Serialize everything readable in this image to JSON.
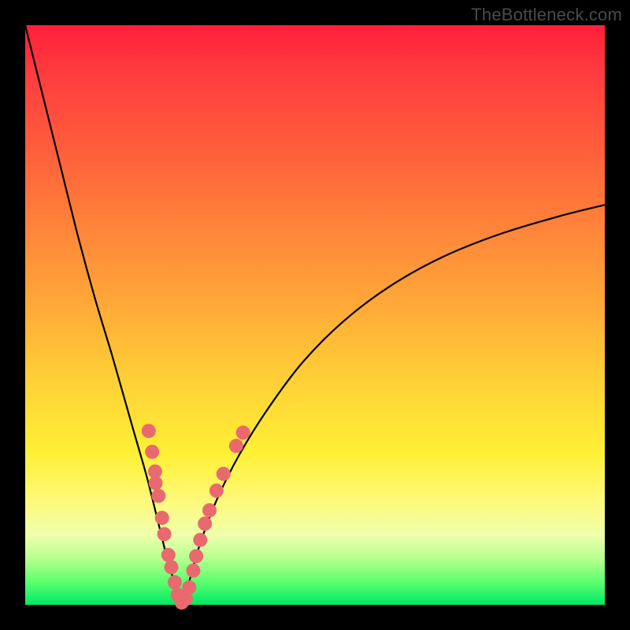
{
  "watermark": "TheBottleneck.com",
  "colors": {
    "frame": "#000000",
    "gradient_top": "#ff1f3a",
    "gradient_bottom": "#00e866",
    "curve": "#000000",
    "dots": "#e86a6f"
  },
  "chart_data": {
    "type": "line",
    "title": "",
    "xlabel": "",
    "ylabel": "",
    "xlim": [
      0,
      100
    ],
    "ylim": [
      0,
      100
    ],
    "grid": false,
    "legend": false,
    "series": [
      {
        "name": "bottleneck-curve",
        "x": [
          0,
          3,
          6,
          9,
          12,
          15,
          17,
          19,
          21,
          23,
          24.5,
          26,
          27,
          28,
          30,
          33,
          37,
          42,
          48,
          55,
          63,
          72,
          82,
          92,
          100
        ],
        "y": [
          100,
          88,
          76,
          64,
          53,
          43,
          36,
          29,
          22,
          14,
          8,
          3,
          0,
          3,
          10,
          18,
          26,
          34,
          42,
          49,
          55,
          60,
          64,
          67,
          69
        ]
      }
    ],
    "markers": [
      {
        "x": 21.3,
        "y": 30.0
      },
      {
        "x": 21.9,
        "y": 26.4
      },
      {
        "x": 22.4,
        "y": 23.0
      },
      {
        "x": 22.5,
        "y": 21.0
      },
      {
        "x": 23.0,
        "y": 18.8
      },
      {
        "x": 23.6,
        "y": 15.0
      },
      {
        "x": 24.0,
        "y": 12.2
      },
      {
        "x": 24.7,
        "y": 8.6
      },
      {
        "x": 25.2,
        "y": 6.5
      },
      {
        "x": 25.8,
        "y": 3.9
      },
      {
        "x": 26.3,
        "y": 1.7
      },
      {
        "x": 27.0,
        "y": 0.4
      },
      {
        "x": 27.7,
        "y": 1.0
      },
      {
        "x": 28.3,
        "y": 3.0
      },
      {
        "x": 29.0,
        "y": 5.9
      },
      {
        "x": 29.5,
        "y": 8.4
      },
      {
        "x": 30.2,
        "y": 11.2
      },
      {
        "x": 31.0,
        "y": 14.0
      },
      {
        "x": 31.8,
        "y": 16.3
      },
      {
        "x": 33.0,
        "y": 19.7
      },
      {
        "x": 34.2,
        "y": 22.6
      },
      {
        "x": 36.4,
        "y": 27.4
      },
      {
        "x": 37.6,
        "y": 29.7
      }
    ]
  }
}
